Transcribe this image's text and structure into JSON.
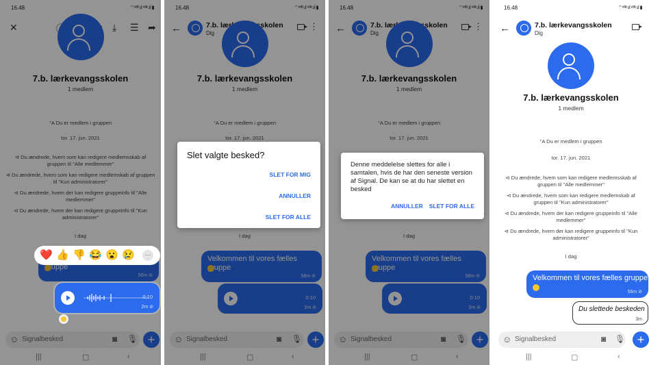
{
  "status": {
    "time": "16.48",
    "signal": "⌔ᵛᵒˡᵗᵉ.ıl ᵛᵒˡᵗᵉ.ıl ▮"
  },
  "conversation": {
    "title": "7.b. lærkevangsskolen",
    "subtitle": "Dig",
    "group_name": "7.b. lærkevangsskolen",
    "members": "1 medlem",
    "you_are_member": "ᐩA  Du er medlem i gruppen",
    "date": "tor. 17. jun. 2021",
    "events": [
      "⊲ Du ændrede, hvem som kan redigere medlemsskab af gruppen til \"Alle medlemmer\"",
      "⊲ Du ændrede, hvem som kan redigere medlemskab af gruppen til \"Kun administratorer\"",
      "⊲ Du ændrede, hvem der kan redigere gruppeinfo til \"Alle medlemmer\"",
      "⊲ Du ændrede, hvem der kan redigere gruppeinfo til \"Kun administratorer\""
    ],
    "today": "I dag",
    "welcome_message": "Velkommen til vores fælles gruppe",
    "welcome_time": "56m ⊘",
    "voice_duration": "0:10",
    "voice_time": "2m ⊘",
    "deleted_message": "Du slettede beskeden",
    "deleted_time": "3m"
  },
  "composer": {
    "placeholder": "Signalbesked"
  },
  "reactions": [
    "❤️",
    "👍",
    "👎",
    "😂",
    "😮",
    "😢",
    "···"
  ],
  "dialog_delete_selected": {
    "title": "Slet valgte besked?",
    "for_me": "SLET FOR MIG",
    "cancel": "ANNULLER",
    "for_all": "SLET FOR ALLE"
  },
  "dialog_confirm_all": {
    "message": "Denne meddelelse slettes for alle i samtalen, hvis de har den seneste version af Signal. De kan se at du har slettet en besked",
    "cancel": "ANNULLER",
    "confirm": "SLET FOR ALLE"
  },
  "colors": {
    "accent": "#2c6bed"
  },
  "icons": [
    "close-icon",
    "info-icon",
    "trash-icon",
    "reply-icon",
    "save-icon",
    "select-multiple-icon",
    "forward-icon",
    "back-arrow-icon",
    "video-call-icon",
    "more-icon",
    "emoji-icon",
    "camera-icon",
    "mic-icon",
    "plus-icon"
  ]
}
